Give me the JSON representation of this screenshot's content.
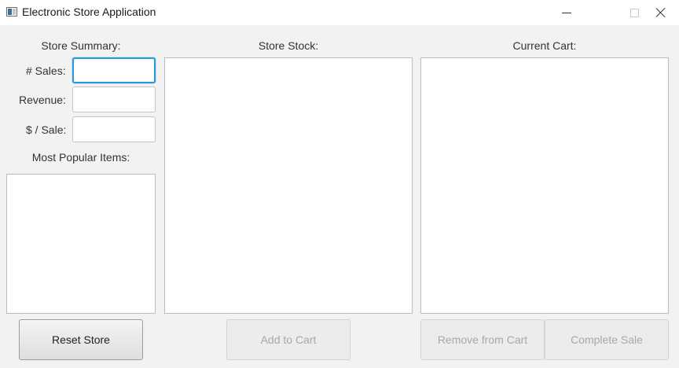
{
  "window": {
    "title": "Electronic Store Application"
  },
  "summary": {
    "heading": "Store Summary:",
    "sales_label": "# Sales:",
    "sales_value": "",
    "revenue_label": "Revenue:",
    "revenue_value": "",
    "per_sale_label": "$ / Sale:",
    "per_sale_value": "",
    "popular_heading": "Most Popular Items:",
    "popular_items": []
  },
  "stock": {
    "heading": "Store Stock:",
    "items": []
  },
  "cart": {
    "heading": "Current Cart:",
    "items": []
  },
  "buttons": {
    "reset": "Reset Store",
    "add": "Add to Cart",
    "remove": "Remove from Cart",
    "complete": "Complete Sale"
  },
  "colors": {
    "focus_accent": "#2a9ad6",
    "window_bg": "#f2f2f2"
  }
}
